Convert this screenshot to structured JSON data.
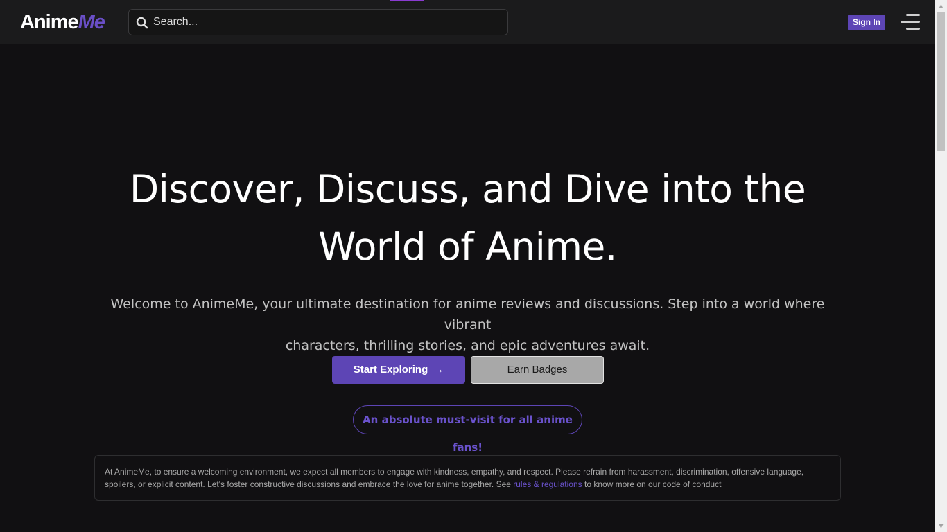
{
  "header": {
    "logo_part1": "Anime",
    "logo_part2": "Me",
    "search_placeholder": "Search...",
    "signin_label": "Sign In"
  },
  "hero": {
    "title_line1": "Discover, Discuss, and Dive into the",
    "title_line2": "World of Anime.",
    "subtitle_line1": "Welcome to AnimeMe, your ultimate destination for anime reviews and discussions. Step into a world where vibrant",
    "subtitle_line2": "characters, thrilling stories, and epic adventures await.",
    "start_label": "Start Exploring",
    "start_arrow": "→",
    "badges_label": "Earn Badges",
    "pill_text": "An absolute must-visit for all anime fans!"
  },
  "notice": {
    "text_before": "At AnimeMe, to ensure a welcoming environment, we expect all members to engage with kindness, empathy, and respect. Please refrain from harassment, discrimination, offensive language, spoilers, or explicit content. Let's foster constructive discussions and embrace the love for anime together. See ",
    "link_text": "rules & regulations",
    "text_after": " to know more on our code of conduct"
  },
  "colors": {
    "accent": "#5d45b5",
    "background": "#111012",
    "header_bg": "#1b1b1c"
  },
  "icons": {
    "search": "search-icon",
    "menu": "menu-icon"
  }
}
